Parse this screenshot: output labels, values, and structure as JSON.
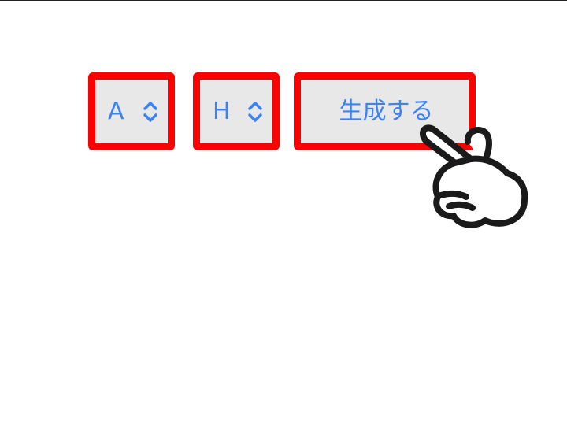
{
  "controls": {
    "select_a": {
      "value": "A",
      "icon": "chevron-updown-icon"
    },
    "select_h": {
      "value": "H",
      "icon": "chevron-updown-icon"
    },
    "generate_button": {
      "label": "生成する"
    }
  },
  "colors": {
    "highlight_border": "#ff0000",
    "text": "#3b82f6",
    "control_bg": "#e8e8e8"
  },
  "annotation": {
    "icon": "pointing-hand-icon"
  }
}
